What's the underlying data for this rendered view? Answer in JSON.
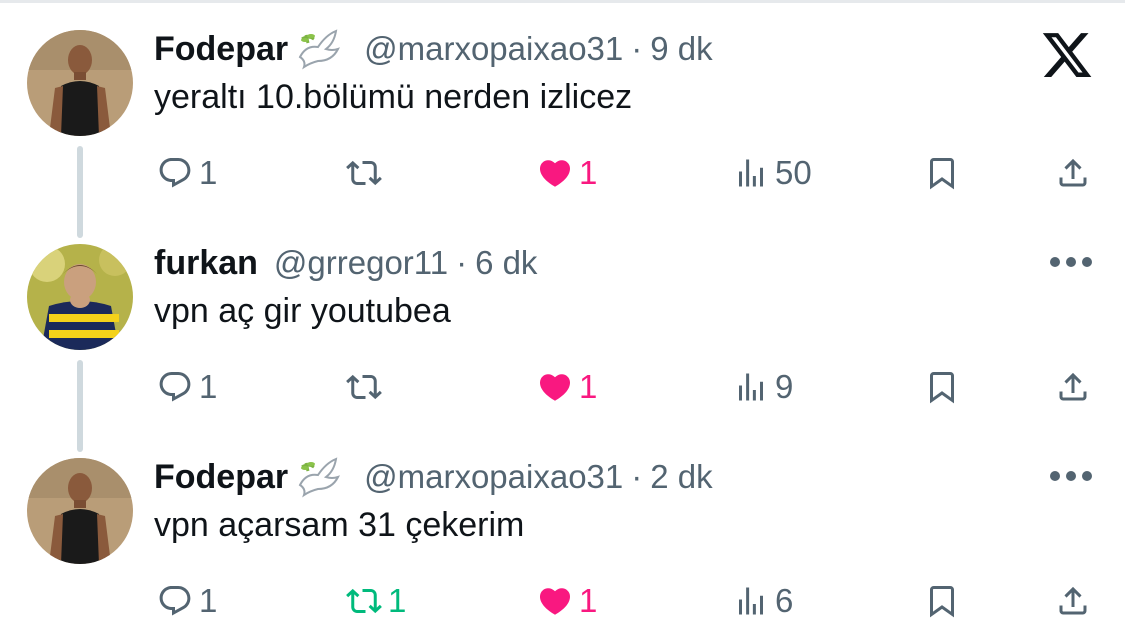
{
  "brand": {
    "logo": "x-logo-icon"
  },
  "colors": {
    "like_active": "#f91880",
    "retweet_active": "#00ba7c",
    "secondary_text": "#536471",
    "primary_text": "#0f1419",
    "thread_line": "#cfd9de"
  },
  "tweets": [
    {
      "name": "Fodepar",
      "badge": "dove-emoji-icon",
      "handle": "@marxopaixao31",
      "separator": "·",
      "time": "9 dk",
      "text": "yeraltı 10.bölümü nerden izlicez",
      "reply_count": "1",
      "retweet_count": "",
      "like_count": "1",
      "view_count": "50",
      "liked": true,
      "retweeted": false
    },
    {
      "name": "furkan",
      "handle": "@grregor11",
      "separator": "·",
      "time": "6 dk",
      "text": "vpn aç gir youtubea",
      "reply_count": "1",
      "retweet_count": "",
      "like_count": "1",
      "view_count": "9",
      "liked": true,
      "retweeted": false
    },
    {
      "name": "Fodepar",
      "badge": "dove-emoji-icon",
      "handle": "@marxopaixao31",
      "separator": "·",
      "time": "2 dk",
      "text": "vpn açarsam 31 çekerim",
      "reply_count": "1",
      "retweet_count": "1",
      "like_count": "1",
      "view_count": "6",
      "liked": true,
      "retweeted": true
    }
  ]
}
